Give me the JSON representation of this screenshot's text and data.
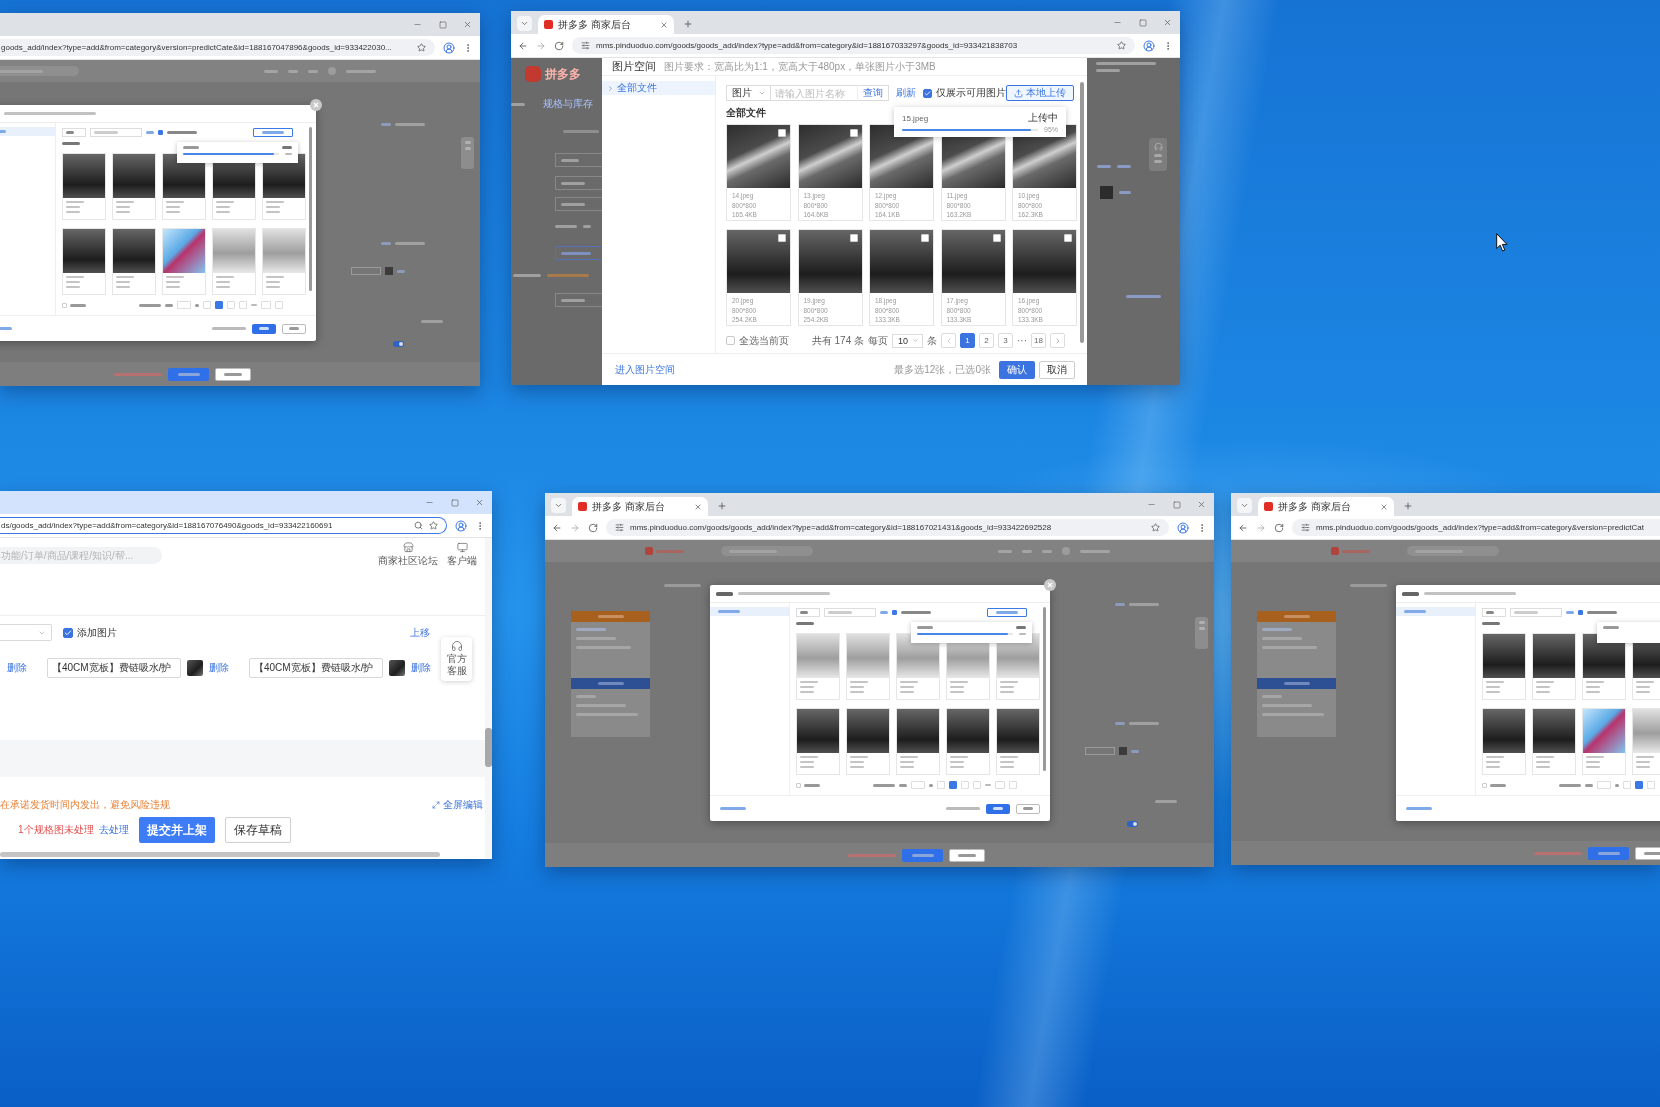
{
  "windows": [
    {
      "kind": "dialog_mini",
      "active": false,
      "url": "goods_add/index?type=add&from=category&version=predictCate&id=188167047896&goods_id=933422030...",
      "available_only_checked": true,
      "upload_progress": {
        "level": 0.95
      },
      "thumbnail_rows": [
        [
          {
            "kind": "pad"
          },
          {
            "kind": "pad"
          },
          {
            "kind": "pad"
          },
          {
            "kind": "pad"
          },
          {
            "kind": "pad"
          }
        ],
        [
          {
            "kind": "pad"
          },
          {
            "kind": "pad"
          },
          {
            "kind": "bright"
          },
          {
            "kind": "pale"
          },
          {
            "kind": "pale"
          }
        ]
      ],
      "select_all_checked": false,
      "pages": [
        {
          "selected": true
        },
        {
          "selected": false
        },
        {
          "selected": false
        }
      ],
      "switch_on": true
    },
    {
      "kind": "image_dialog",
      "active": false,
      "tab_title": "拼多多 商家后台",
      "url": "mms.pinduoduo.com/goods/goods_add/index?type=add&from=category&id=188167033297&goods_id=933421838703",
      "page": {
        "logo": "拼多多",
        "nav_link": "规格与库存"
      },
      "dialog": {
        "title": "图片空间",
        "requirements": "图片要求：宽高比为1:1，宽高大于480px，单张图片小于3MB",
        "folders": [
          {
            "label": "全部文件",
            "selected": true
          }
        ],
        "type_select": "图片",
        "search_placeholder": "请输入图片名称",
        "search_button": "查询",
        "refresh": "刷新",
        "available_only": {
          "label": "仅展示可用图片",
          "checked": true
        },
        "upload_button": "本地上传",
        "upload": {
          "file": "15.jpeg",
          "status": "上传中",
          "level": 0.95,
          "percent": "95%"
        },
        "section": "全部文件",
        "images": [
          {
            "name": "14.jpeg",
            "dimensions": "800*800",
            "size": "165.4KB",
            "kind": "floor",
            "checked": false
          },
          {
            "name": "13.jpeg",
            "dimensions": "800*800",
            "size": "164.6KB",
            "kind": "floor",
            "checked": false
          },
          {
            "name": "12.jpeg",
            "dimensions": "800*800",
            "size": "164.1KB",
            "kind": "floor"
          },
          {
            "name": "11.jpeg",
            "dimensions": "800*800",
            "size": "163.2KB",
            "kind": "floor"
          },
          {
            "name": "10.jpeg",
            "dimensions": "800*800",
            "size": "162.3KB",
            "kind": "floor"
          },
          {
            "name": "20.jpeg",
            "dimensions": "800*800",
            "size": "254.2KB",
            "kind": "pad",
            "checked": false
          },
          {
            "name": "19.jpeg",
            "dimensions": "800*800",
            "size": "254.2KB",
            "kind": "pad",
            "checked": false
          },
          {
            "name": "18.jpeg",
            "dimensions": "800*800",
            "size": "133.3KB",
            "kind": "pad",
            "checked": false
          },
          {
            "name": "17.jpeg",
            "dimensions": "800*800",
            "size": "133.3KB",
            "kind": "pad",
            "checked": false
          },
          {
            "name": "16.jpeg",
            "dimensions": "800*800",
            "size": "133.3KB",
            "kind": "pad",
            "checked": false
          }
        ],
        "select_page": {
          "label": "全选当前页",
          "checked": false
        },
        "total": "共有 174 条",
        "per_page_label": "每页",
        "per_page": "10",
        "per_page_unit": "条",
        "pages": [
          {
            "label": "1",
            "selected": true
          },
          {
            "label": "2",
            "selected": false
          },
          {
            "label": "3",
            "selected": false
          }
        ],
        "ellipsis": "···",
        "last_page": {
          "label": "18",
          "selected": false
        },
        "entry_link": "进入图片空间",
        "selection_note": "最多选12张，已选0张",
        "confirm": "确认",
        "cancel": "取消"
      }
    },
    {
      "kind": "product_form",
      "active": true,
      "url": "ds/goods_add/index?type=add&from=category&id=188167076490&goods_id=933422160691",
      "header": {
        "search_placeholder": "功能/订单/商品/课程/知识/帮...",
        "links": [
          {
            "label": "商家社区论坛",
            "kind": "community"
          },
          {
            "label": "客户端",
            "kind": "client"
          }
        ]
      },
      "spec": {
        "add_image": {
          "label": "添加图片",
          "checked": true
        },
        "move_up": "上移",
        "items": [
          {
            "delete": "删除"
          },
          {
            "value": "【40CM宽板】费链吸水/护",
            "delete": "删除"
          },
          {
            "value": "【40CM宽板】费链吸水/护",
            "delete": "删除"
          }
        ]
      },
      "service_widget": "官方客服",
      "notice": "在承诺发货时间内发出，避免风险违规",
      "fullscreen_edit": "全屏编辑",
      "footer": {
        "warning": "1个规格图未处理",
        "fix_link": "去处理",
        "submit": "提交并上架",
        "save_draft": "保存草稿"
      }
    },
    {
      "kind": "dialog_mini",
      "active": false,
      "tab_title": "拼多多 商家后台",
      "url": "mms.pinduoduo.com/goods/goods_add/index?type=add&from=category&id=188167021431&goods_id=933422692528",
      "available_only_checked": true,
      "upload_progress": {
        "level": 0.95
      },
      "thumbnail_rows": [
        [
          {
            "kind": "pale"
          },
          {
            "kind": "pale"
          },
          {
            "kind": "pale"
          },
          {
            "kind": "pale"
          },
          {
            "kind": "pale"
          }
        ],
        [
          {
            "kind": "pad"
          },
          {
            "kind": "pad"
          },
          {
            "kind": "pad"
          },
          {
            "kind": "pad"
          },
          {
            "kind": "pad"
          }
        ]
      ],
      "select_all_checked": false,
      "pages": [
        {
          "selected": true
        },
        {
          "selected": false
        },
        {
          "selected": false
        }
      ],
      "switch_on": true
    },
    {
      "kind": "dialog_mini",
      "active": false,
      "tab_title": "拼多多 商家后台",
      "url": "mms.pinduoduo.com/goods/goods_add/index?type=add&from=category&version=predictCat",
      "available_only_checked": true,
      "thumbnail_rows": [
        [
          {
            "kind": "pad"
          },
          {
            "kind": "pad"
          },
          {
            "kind": "pad"
          },
          {
            "kind": "pad"
          }
        ],
        [
          {
            "kind": "pad"
          },
          {
            "kind": "pad"
          },
          {
            "kind": "bright"
          },
          {
            "kind": "pale"
          }
        ]
      ],
      "select_all_checked": false,
      "pages": [
        {
          "selected": true
        },
        {
          "selected": false
        }
      ]
    }
  ]
}
